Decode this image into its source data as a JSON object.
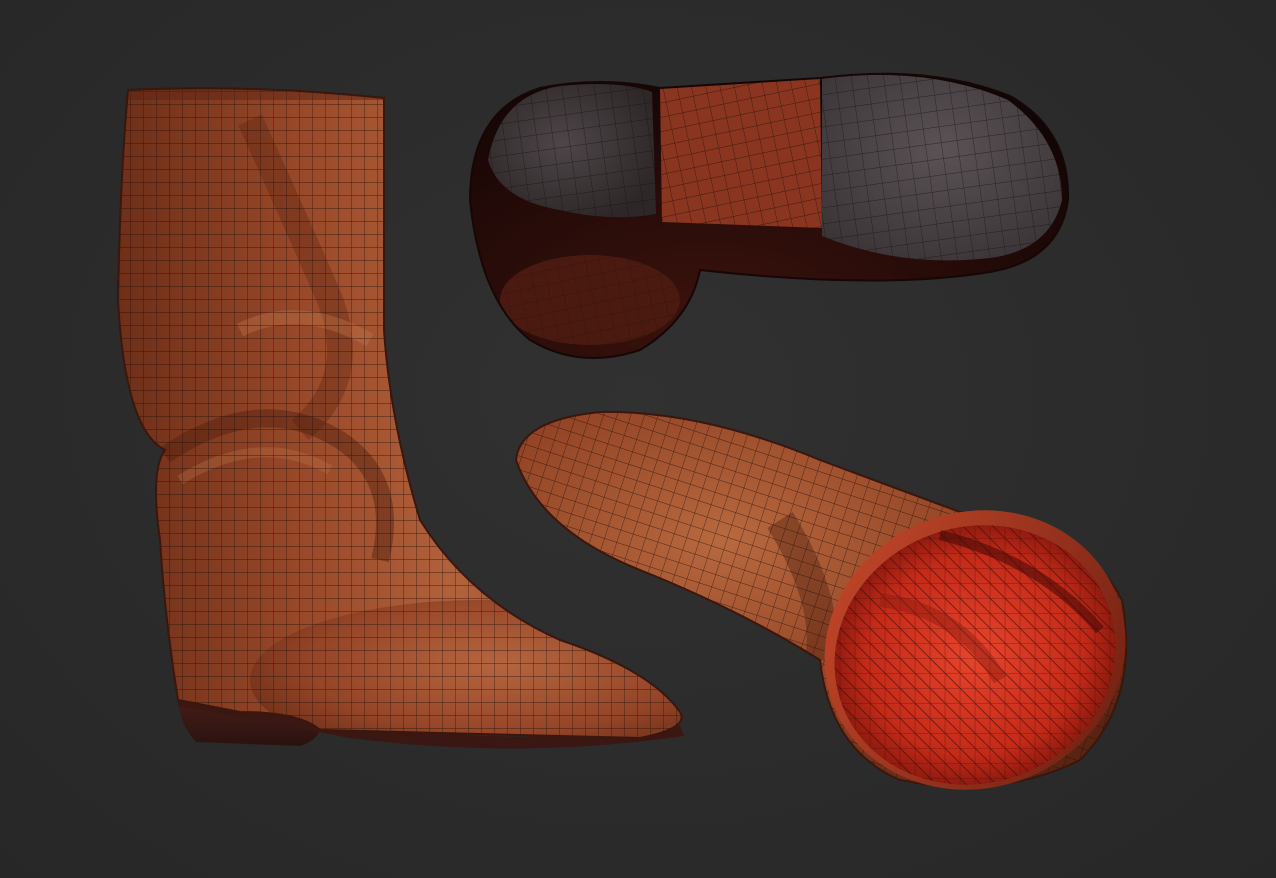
{
  "scene": {
    "background_color": "#2b2b2b",
    "models": [
      {
        "name": "boot-side-view",
        "view": "side"
      },
      {
        "name": "boot-sole-view",
        "view": "bottom"
      },
      {
        "name": "boot-opening-view",
        "view": "top-opening"
      }
    ],
    "materials": {
      "leather": "#8a3f22",
      "leather_light": "#b0603a",
      "leather_dark": "#4a1e12",
      "heel": "#3a1a14",
      "sole_gray": "#4a4446",
      "lining_red": "#d8321f",
      "wire": "#1e0c08"
    },
    "overlay": "wireframe-quad-grid"
  }
}
